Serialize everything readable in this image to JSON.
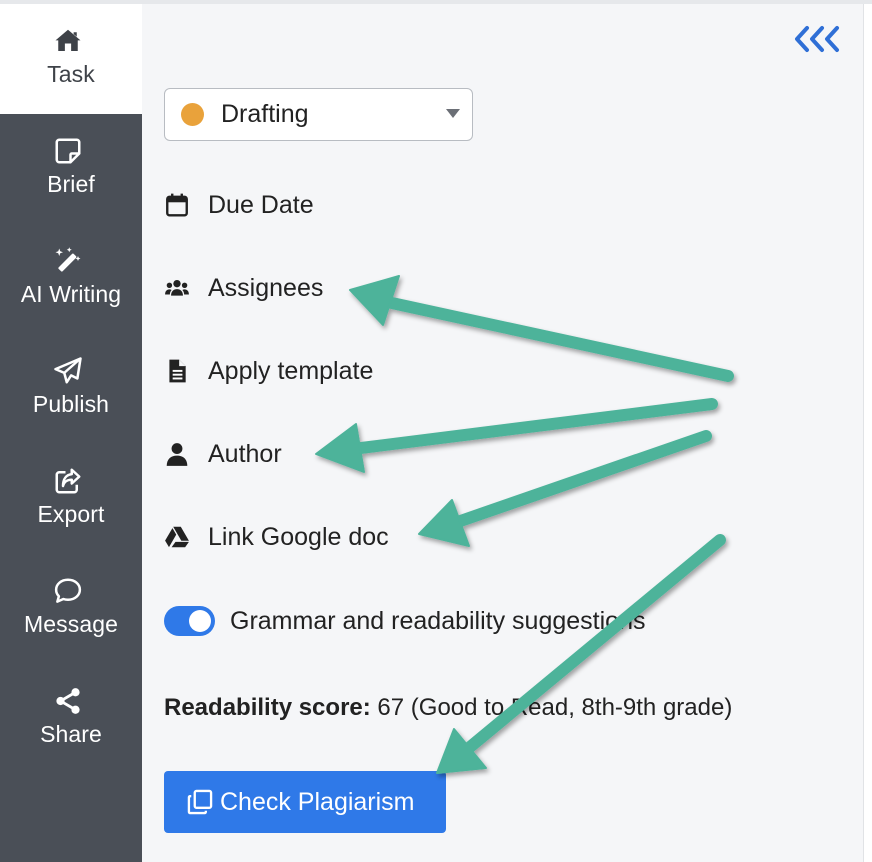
{
  "sidebar": {
    "items": [
      {
        "label": "Task",
        "icon": "home-icon",
        "active": true
      },
      {
        "label": "Brief",
        "icon": "note-icon"
      },
      {
        "label": "AI Writing",
        "icon": "magic-wand-icon"
      },
      {
        "label": "Publish",
        "icon": "paper-plane-icon"
      },
      {
        "label": "Export",
        "icon": "share-square-icon"
      },
      {
        "label": "Message",
        "icon": "speech-bubble-icon"
      },
      {
        "label": "Share",
        "icon": "share-nodes-icon"
      }
    ]
  },
  "main": {
    "collapse_label": "<<<",
    "status": {
      "value": "Drafting",
      "dot_color": "#e9a23b"
    },
    "rows": [
      {
        "label": "Due Date",
        "icon": "calendar-icon"
      },
      {
        "label": "Assignees",
        "icon": "users-icon"
      },
      {
        "label": "Apply template",
        "icon": "document-icon"
      },
      {
        "label": "Author",
        "icon": "user-icon"
      },
      {
        "label": "Link Google doc",
        "icon": "google-drive-icon"
      }
    ],
    "grammar_toggle": {
      "label": "Grammar and readability suggestions",
      "on": true
    },
    "readability": {
      "label": "Readability score:",
      "value": "67 (Good to Read, 8th-9th grade)"
    },
    "plagiarism_button": {
      "label": "Check Plagiarism",
      "icon": "copy-icon"
    }
  },
  "colors": {
    "sidebar_bg": "#4a4f57",
    "accent": "#2f79e8",
    "arrow": "#4db39a"
  }
}
